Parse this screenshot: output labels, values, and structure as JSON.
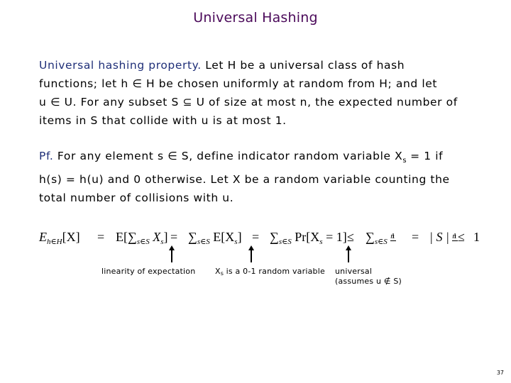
{
  "slide": {
    "title": "Universal Hashing",
    "page_number": "37"
  },
  "property": {
    "lead": "Universal hashing property.",
    "line1_rest": "  Let H be a universal class of hash",
    "line2": "functions; let h ∈ H be chosen uniformly at random from H; and let",
    "line3": "u ∈ U.  For any subset S ⊆ U of size at most n, the expected number of",
    "line4": "items in S that collide with u is at most 1."
  },
  "proof": {
    "lead": "Pf.",
    "line1_a": "  For any element s ∈ S, define indicator random variable X",
    "line1_sub": "s",
    "line1_b": " = 1 if",
    "line2": "h(s) = h(u)  and 0 otherwise. Let X be a random variable counting the",
    "line3": "total number of collisions with u."
  },
  "equation": {
    "t1_E": "E",
    "t1_sub": "h∈H",
    "t1_rest": "[X]",
    "eq1": "=",
    "t2": "E[∑",
    "t2_sub": "s∈S",
    "t2_rest": " X",
    "t2_sub2": "s",
    "t2_end": "]",
    "eq2": "=",
    "t3": "∑",
    "t3_sub": "s∈S",
    "t3_rest": " E[X",
    "t3_sub2": "s",
    "t3_end": "]",
    "eq3": "=",
    "t4": "∑",
    "t4_sub": "s∈S",
    "t4_rest": " Pr[X",
    "t4_sub2": "s",
    "t4_end": " = 1]",
    "le1": "≤",
    "t5": "∑",
    "t5_sub": "s∈S",
    "frac_num": "1",
    "frac_den": "n",
    "eq4": "=",
    "t6": "| S |",
    "le2": "≤",
    "t7": "1"
  },
  "annotations": {
    "linearity": "linearity of expectation",
    "indicator_a": "X",
    "indicator_sub": "s",
    "indicator_b": " is a 0-1 random variable",
    "universal_l1": "universal",
    "universal_l2": "(assumes u ∉ S)"
  }
}
